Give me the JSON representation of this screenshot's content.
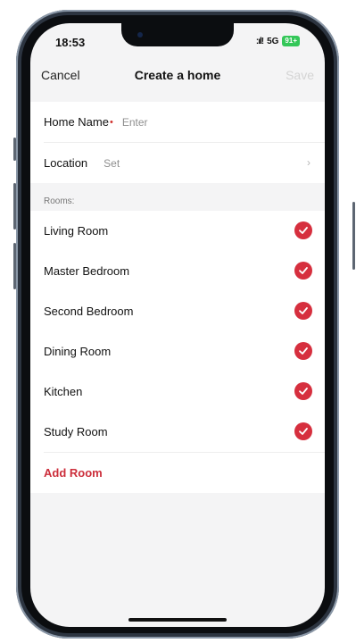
{
  "status_bar": {
    "time": "18:53",
    "network": "5G",
    "battery": "91+"
  },
  "nav": {
    "cancel_label": "Cancel",
    "title": "Create a home",
    "save_label": "Save"
  },
  "form": {
    "home_name": {
      "label": "Home Name",
      "required_mark": "•",
      "placeholder": "Enter"
    },
    "location": {
      "label": "Location",
      "value": "Set"
    }
  },
  "rooms": {
    "section_label": "Rooms:",
    "items": [
      {
        "label": "Living Room",
        "checked": true
      },
      {
        "label": "Master Bedroom",
        "checked": true
      },
      {
        "label": "Second Bedroom",
        "checked": true
      },
      {
        "label": "Dining Room",
        "checked": true
      },
      {
        "label": "Kitchen",
        "checked": true
      },
      {
        "label": "Study Room",
        "checked": true
      }
    ],
    "add_label": "Add Room"
  },
  "colors": {
    "accent": "#d62f3e",
    "background": "#f4f4f5"
  }
}
